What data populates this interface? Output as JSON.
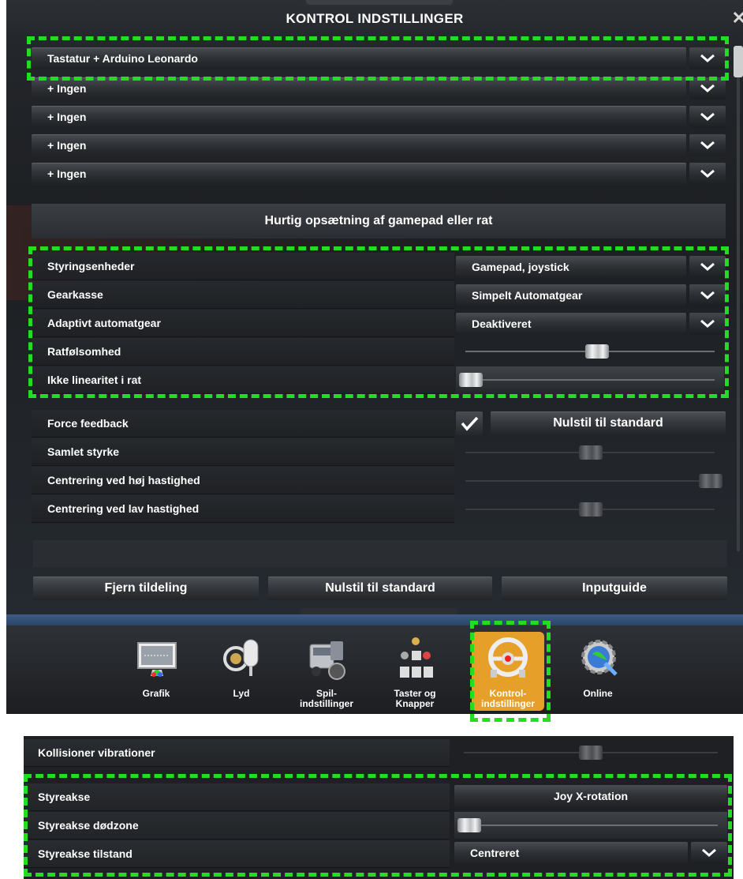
{
  "window": {
    "title": "KONTROL INDSTILLINGER",
    "close_icon": "close-icon"
  },
  "devices": [
    {
      "label": "Tastatur + Arduino Leonardo"
    },
    {
      "label": "+ Ingen"
    },
    {
      "label": "+ Ingen"
    },
    {
      "label": "+ Ingen"
    },
    {
      "label": "+ Ingen"
    }
  ],
  "quick_setup": {
    "label": "Hurtig opsætning af gamepad eller rat"
  },
  "settings": {
    "steering_devices": {
      "label": "Styringsenheder",
      "value": "Gamepad, joystick"
    },
    "gearbox": {
      "label": "Gearkasse",
      "value": "Simpelt Automatgear"
    },
    "adaptive_auto": {
      "label": "Adaptivt automatgear",
      "value": "Deaktiveret"
    },
    "wheel_sensitivity": {
      "label": "Ratfølsomhed",
      "level": 0.5
    },
    "wheel_nonlinearity": {
      "label": "Ikke linearitet i rat",
      "level": 0.0
    }
  },
  "force_feedback": {
    "label": "Force feedback",
    "checked": true,
    "reset_label": "Nulstil til standard",
    "overall_strength": {
      "label": "Samlet styrke",
      "level": 0.5
    },
    "centering_high": {
      "label": "Centrering ved høj hastighed",
      "level": 1.0
    },
    "centering_low": {
      "label": "Centrering ved lav hastighed",
      "level": 0.5
    }
  },
  "footer_buttons": {
    "remove": "Fjern tildeling",
    "reset": "Nulstil til standard",
    "guide": "Inputguide"
  },
  "nav": [
    {
      "label": "Grafik",
      "icon": "monitor-icon"
    },
    {
      "label": "Lyd",
      "icon": "microphone-icon"
    },
    {
      "label": "Spil-\nindstillinger",
      "icon": "truck-icon"
    },
    {
      "label": "Taster og\nKnapper",
      "icon": "keys-icon"
    },
    {
      "label": "Kontrol-\nindstillinger",
      "icon": "steering-wheel-icon",
      "active": true
    },
    {
      "label": "Online",
      "icon": "globe-gear-icon"
    }
  ],
  "lower_panel": {
    "collision_vibrations": {
      "label": "Kollisioner vibrationer",
      "level": 0.5
    },
    "steering_axis": {
      "label": "Styreakse",
      "value": "Joy X-rotation"
    },
    "steering_deadzone": {
      "label": "Styreakse dødzone",
      "level": 0.0
    },
    "steering_axis_mode": {
      "label": "Styreakse tilstand",
      "value": "Centreret"
    }
  },
  "colors": {
    "highlight": "#22dd22",
    "active_tab": "#e6a02a"
  }
}
